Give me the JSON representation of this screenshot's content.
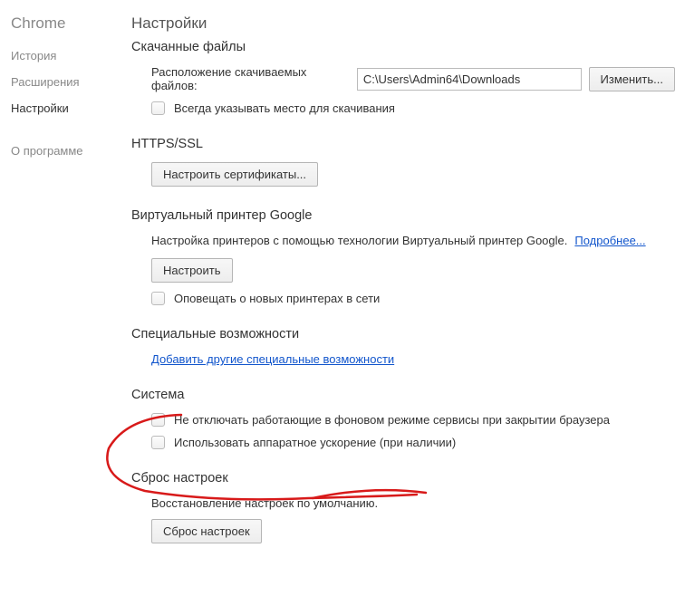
{
  "sidebar": {
    "title": "Chrome",
    "items": [
      {
        "label": "История"
      },
      {
        "label": "Расширения"
      },
      {
        "label": "Настройки",
        "active": true
      }
    ],
    "about": "О программе"
  },
  "page": {
    "title": "Настройки"
  },
  "sections": {
    "downloads": {
      "title": "Скачанные файлы",
      "locationLabel": "Расположение скачиваемых файлов:",
      "locationValue": "C:\\Users\\Admin64\\Downloads",
      "changeBtn": "Изменить...",
      "askCheckbox": "Всегда указывать место для скачивания"
    },
    "https": {
      "title": "HTTPS/SSL",
      "certBtn": "Настроить сертификаты..."
    },
    "cloudprint": {
      "title": "Виртуальный принтер Google",
      "desc": "Настройка принтеров с помощью технологии Виртуальный принтер Google. ",
      "moreLink": "Подробнее...",
      "configureBtn": "Настроить",
      "notifyCheckbox": "Оповещать о новых принтерах в сети"
    },
    "accessibility": {
      "title": "Специальные возможности",
      "addLink": "Добавить другие специальные возможности"
    },
    "system": {
      "title": "Система",
      "bgCheckbox": "Не отключать работающие в фоновом режиме сервисы при закрытии браузера",
      "hwCheckbox": "Использовать аппаратное ускорение (при наличии)"
    },
    "reset": {
      "title": "Сброс настроек",
      "desc": "Восстановление настроек по умолчанию.",
      "resetBtn": "Сброс настроек"
    }
  }
}
